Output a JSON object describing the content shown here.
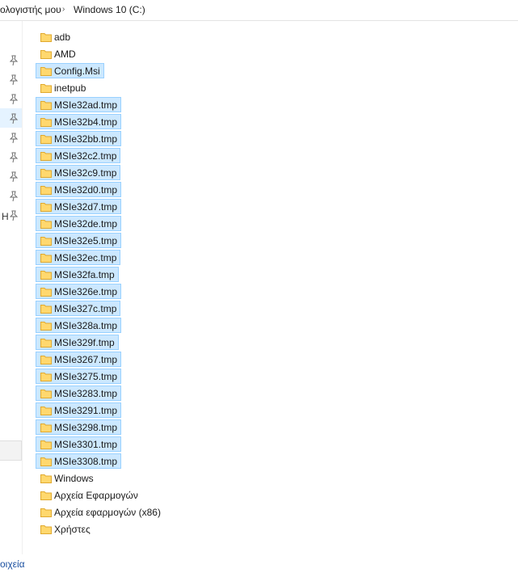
{
  "address": {
    "segments": [
      "ολογιστής μου",
      "Windows 10 (C:)"
    ],
    "separator": "›"
  },
  "nav": {
    "partial_glyph": "Η"
  },
  "files": [
    {
      "name": "adb",
      "selected": false
    },
    {
      "name": "AMD",
      "selected": false
    },
    {
      "name": "Config.Msi",
      "selected": true
    },
    {
      "name": "inetpub",
      "selected": false
    },
    {
      "name": "MSIe32ad.tmp",
      "selected": true
    },
    {
      "name": "MSIe32b4.tmp",
      "selected": true
    },
    {
      "name": "MSIe32bb.tmp",
      "selected": true
    },
    {
      "name": "MSIe32c2.tmp",
      "selected": true
    },
    {
      "name": "MSIe32c9.tmp",
      "selected": true
    },
    {
      "name": "MSIe32d0.tmp",
      "selected": true
    },
    {
      "name": "MSIe32d7.tmp",
      "selected": true
    },
    {
      "name": "MSIe32de.tmp",
      "selected": true
    },
    {
      "name": "MSIe32e5.tmp",
      "selected": true
    },
    {
      "name": "MSIe32ec.tmp",
      "selected": true
    },
    {
      "name": "MSIe32fa.tmp",
      "selected": true
    },
    {
      "name": "MSIe326e.tmp",
      "selected": true
    },
    {
      "name": "MSIe327c.tmp",
      "selected": true
    },
    {
      "name": "MSIe328a.tmp",
      "selected": true
    },
    {
      "name": "MSIe329f.tmp",
      "selected": true
    },
    {
      "name": "MSIe3267.tmp",
      "selected": true
    },
    {
      "name": "MSIe3275.tmp",
      "selected": true
    },
    {
      "name": "MSIe3283.tmp",
      "selected": true
    },
    {
      "name": "MSIe3291.tmp",
      "selected": true
    },
    {
      "name": "MSIe3298.tmp",
      "selected": true
    },
    {
      "name": "MSIe3301.tmp",
      "selected": true
    },
    {
      "name": "MSIe3308.tmp",
      "selected": true
    },
    {
      "name": "Windows",
      "selected": false
    },
    {
      "name": "Αρχεία Εφαρμογών",
      "selected": false
    },
    {
      "name": "Αρχεία εφαρμογών (x86)",
      "selected": false
    },
    {
      "name": "Χρήστες",
      "selected": false
    }
  ],
  "status": {
    "text": "οιχεία"
  },
  "colors": {
    "selection_bg": "#cce8ff",
    "selection_border": "#99d1ff",
    "folder_fill": "#ffd86e",
    "folder_edge": "#e0a92e",
    "status_text": "#1a4fa0"
  },
  "icons": {
    "pin": "pin-icon",
    "folder": "folder-icon",
    "chevron": "chevron-right-icon"
  }
}
